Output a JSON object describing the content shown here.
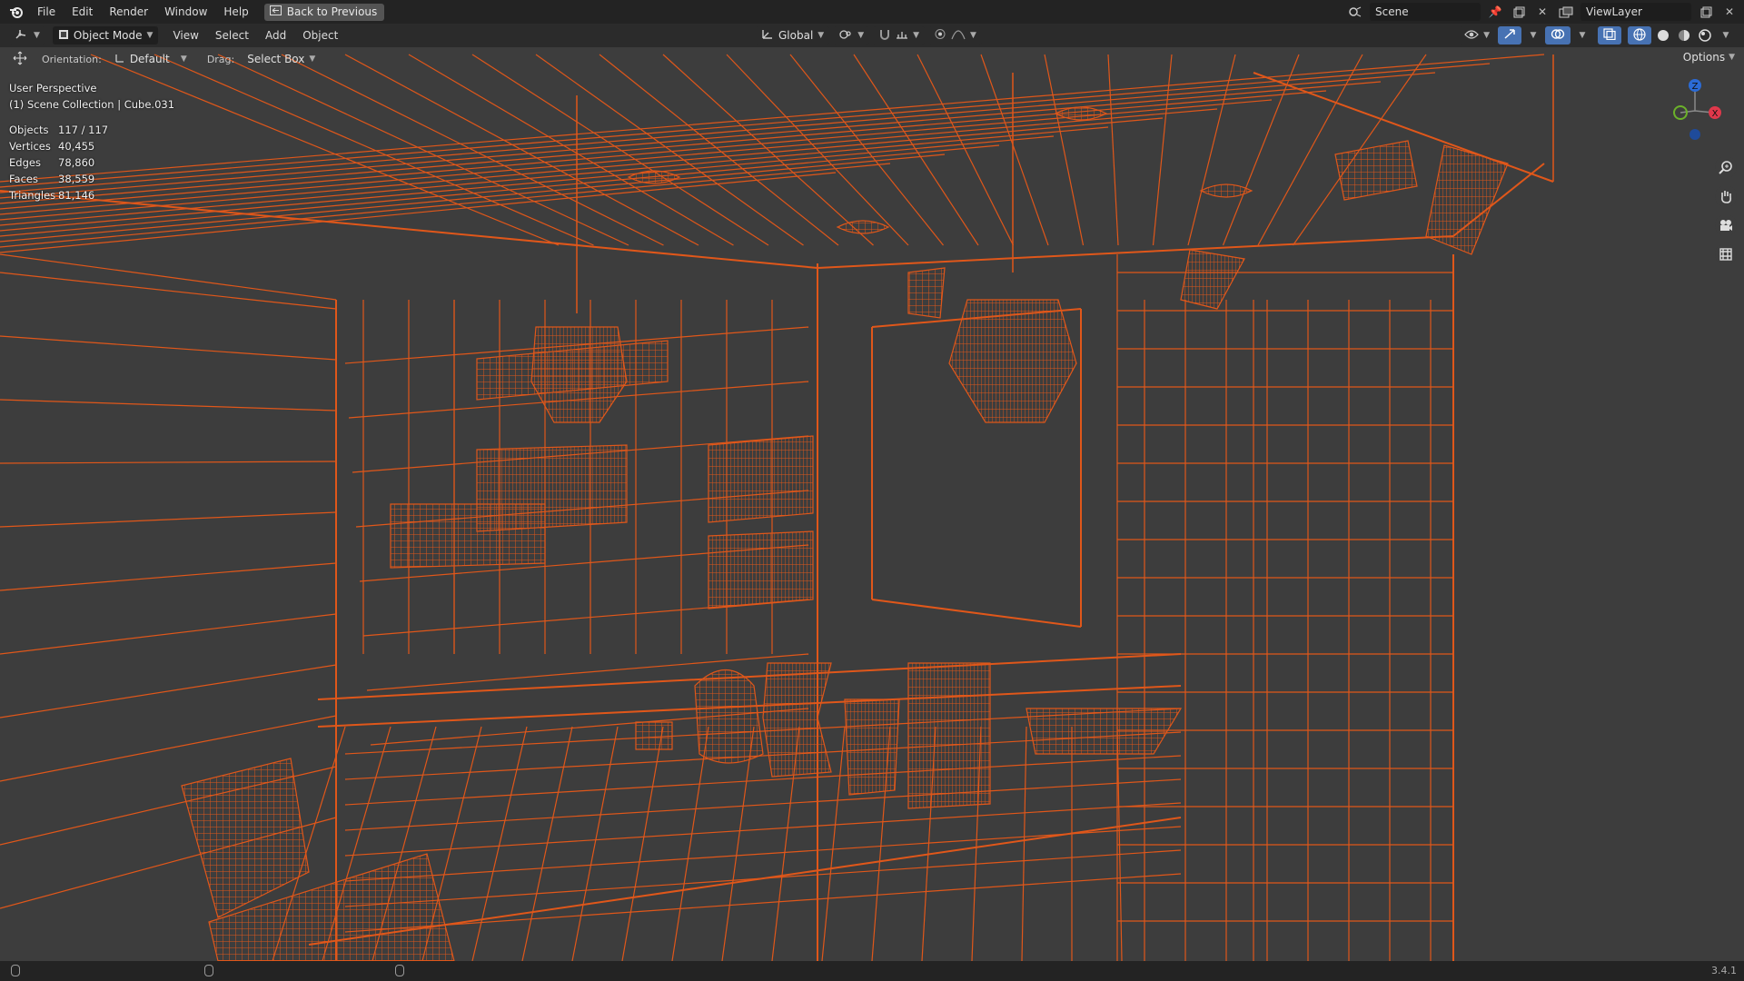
{
  "topbar": {
    "menus": [
      "File",
      "Edit",
      "Render",
      "Window",
      "Help"
    ],
    "back_button": "Back to Previous",
    "scene_name": "Scene",
    "view_layer": "ViewLayer"
  },
  "header": {
    "mode": "Object Mode",
    "menus": [
      "View",
      "Select",
      "Add",
      "Object"
    ],
    "transform_orientation": "Global"
  },
  "tool_header": {
    "orientation_label": "Orientation:",
    "orientation_value": "Default",
    "drag_label": "Drag:",
    "drag_value": "Select Box",
    "options_label": "Options"
  },
  "viewport": {
    "view_name": "User Perspective",
    "collection": "(1) Scene Collection | Cube.031",
    "stats": [
      {
        "label": "Objects",
        "value": "117 / 117"
      },
      {
        "label": "Vertices",
        "value": "40,455"
      },
      {
        "label": "Edges",
        "value": "78,860"
      },
      {
        "label": "Faces",
        "value": "38,559"
      },
      {
        "label": "Triangles",
        "value": "81,146"
      }
    ],
    "gizmo_axes": {
      "x": "X",
      "z": "Z"
    },
    "wire_color": "#e0571a",
    "background_color": "#3d3d3d"
  },
  "statusbar": {
    "version": "3.4.1"
  },
  "icons": [
    "blender-logo-icon",
    "back-icon",
    "scene-icon",
    "pin-icon",
    "new-icon",
    "close-icon",
    "viewlayer-icon",
    "editor-type-icon",
    "object-mode-icon",
    "global-orientation-icon",
    "pivot-icon",
    "snap-icon",
    "proportional-icon",
    "visibility-icon",
    "gizmo-icon",
    "overlay-icon",
    "xray-icon",
    "wireframe-shading-icon",
    "solid-shading-icon",
    "material-shading-icon",
    "rendered-shading-icon",
    "move-tool-icon",
    "zoom-icon",
    "pan-hand-icon",
    "camera-icon",
    "grid-icon",
    "mouse-left-icon",
    "mouse-middle-icon",
    "mouse-right-icon"
  ]
}
